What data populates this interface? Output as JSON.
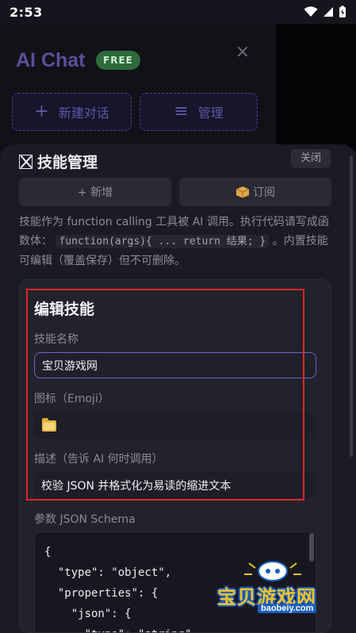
{
  "status_bar": {
    "time": "2:53"
  },
  "background_app": {
    "title": "AI Chat",
    "badge": "FREE",
    "new_chat_label": "新建对话",
    "manage_label": "管理",
    "accent_color": "#5a4f9c"
  },
  "skills_panel": {
    "title": "技能管理",
    "close_label": "关闭",
    "add_label": "+ 新增",
    "subscribe_label": "订阅",
    "description_prefix": "技能作为 function calling 工具被 AI 调用。执行代码请写成函数体：",
    "description_code": "function(args){ ... return 结果; }",
    "description_suffix": "。内置技能可编辑（覆盖保存）但不可删除。"
  },
  "editor": {
    "title": "编辑技能",
    "name_label": "技能名称",
    "name_value": "宝贝游戏网",
    "icon_label": "图标（Emoji）",
    "icon_value": "folder",
    "desc_label": "描述（告诉 AI 何时调用）",
    "desc_value": "校验 JSON 并格式化为易读的缩进文本",
    "schema_label": "参数 JSON Schema",
    "schema_lines": [
      "{",
      "  \"type\": \"object\",",
      "  \"properties\": {",
      "    \"json\": {",
      "      \"type\": \"string\""
    ]
  },
  "watermark": {
    "text": "宝贝游戏网",
    "domain": "baobeiy.com"
  },
  "colors": {
    "highlight": "#e0242b",
    "focus": "#6f63c9"
  }
}
